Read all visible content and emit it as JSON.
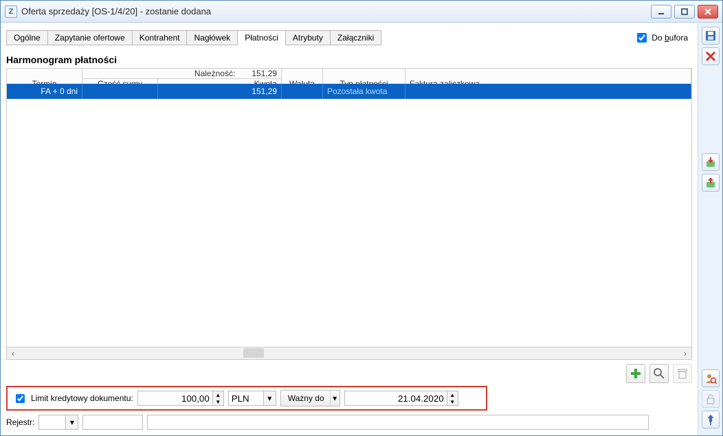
{
  "window": {
    "app_icon_text": "Z",
    "title": "Oferta sprzedaży [OS-1/4/20] - zostanie dodana"
  },
  "tabs": {
    "items": [
      "Ogólne",
      "Zapytanie ofertowe",
      "Kontrahent",
      "Nagłówek",
      "Płatności",
      "Atrybuty",
      "Załączniki"
    ],
    "active_index": 4
  },
  "buffer_checkbox": {
    "label_pre": "Do ",
    "label_accel": "b",
    "label_post": "ufora",
    "checked": true
  },
  "section_title": "Harmonogram płatności",
  "grid": {
    "header": {
      "termin": "Termin",
      "naleznosc_label": "Należność:",
      "naleznosc_value": "151,29",
      "czesc_sumy": "Część sumy",
      "kwota": "Kwota",
      "waluta": "Waluta",
      "typ": "Typ płatności",
      "faktura": "Faktura zaliczkowa"
    },
    "rows": [
      {
        "termin": "FA + 0 dni",
        "czesc": "",
        "kwota": "151,29",
        "waluta": "",
        "typ": "Pozostała kwota",
        "faktura": ""
      }
    ]
  },
  "chart_data": {
    "type": "table",
    "columns": [
      "Termin",
      "Część sumy",
      "Kwota",
      "Waluta",
      "Typ płatności",
      "Faktura zaliczkowa"
    ],
    "rows": [
      [
        "FA + 0 dni",
        "",
        "151,29",
        "",
        "Pozostała kwota",
        ""
      ]
    ],
    "totals": {
      "Należność": "151,29"
    }
  },
  "limit": {
    "checked": true,
    "label": "Limit kredytowy dokumentu:",
    "amount": "100,00",
    "currency": "PLN",
    "valid_label": "Ważny do",
    "valid_date": "21.04.2020"
  },
  "register": {
    "label": "Rejestr:",
    "value": "",
    "display1": "",
    "display2": ""
  },
  "icons": {
    "save": "save-icon",
    "delete": "delete-icon",
    "import": "import-icon",
    "export": "export-icon",
    "user": "user-detail-icon",
    "lock": "lock-open-icon",
    "pin": "pin-icon",
    "add": "plus-icon",
    "search": "magnifier-icon",
    "trash": "trash-icon"
  }
}
